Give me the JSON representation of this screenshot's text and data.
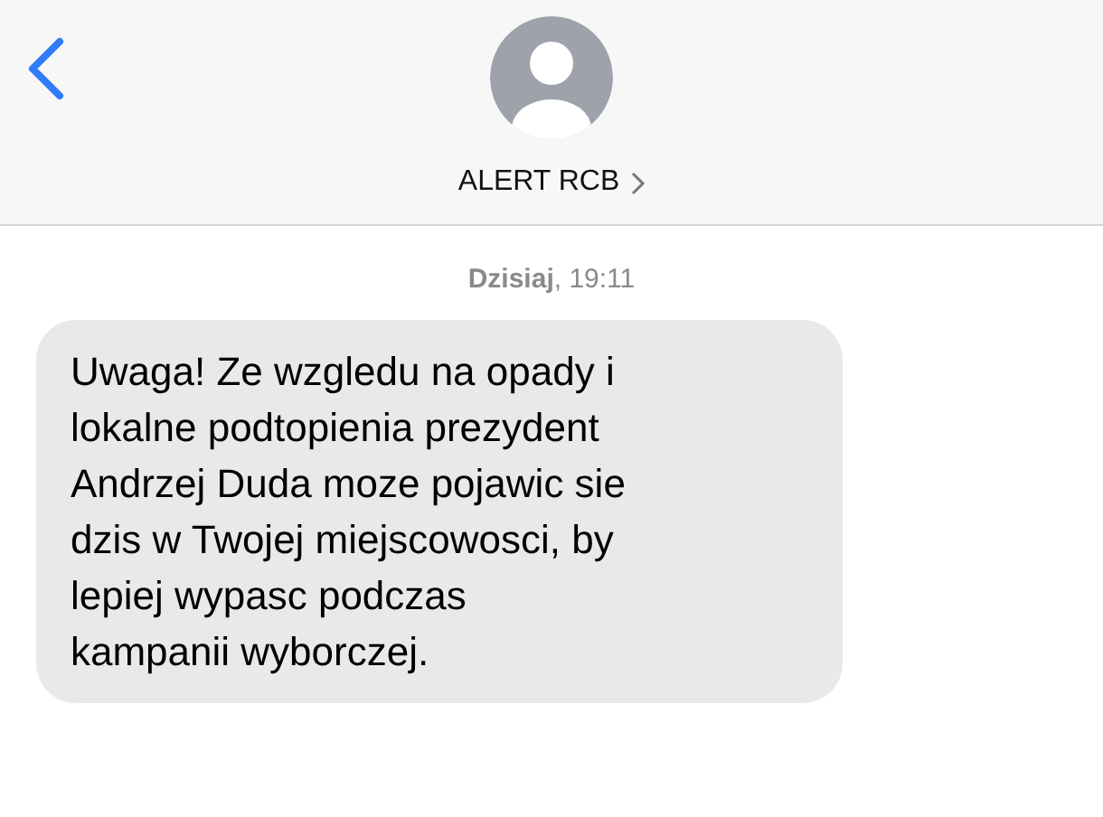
{
  "header": {
    "contact_name": "ALERT RCB"
  },
  "timestamp": "**Dzisiaj**, 19:11",
  "messages": [
    {
      "kind": "received",
      "text": "Uwaga! Ze wzgledu na opady i\nlokalne podtopienia prezydent\nAndrzej Duda moze pojawic sie\ndzis w Twojej miejscowosci, by\nlepiej wypasc podczas\nkampanii wyborczej."
    }
  ]
}
